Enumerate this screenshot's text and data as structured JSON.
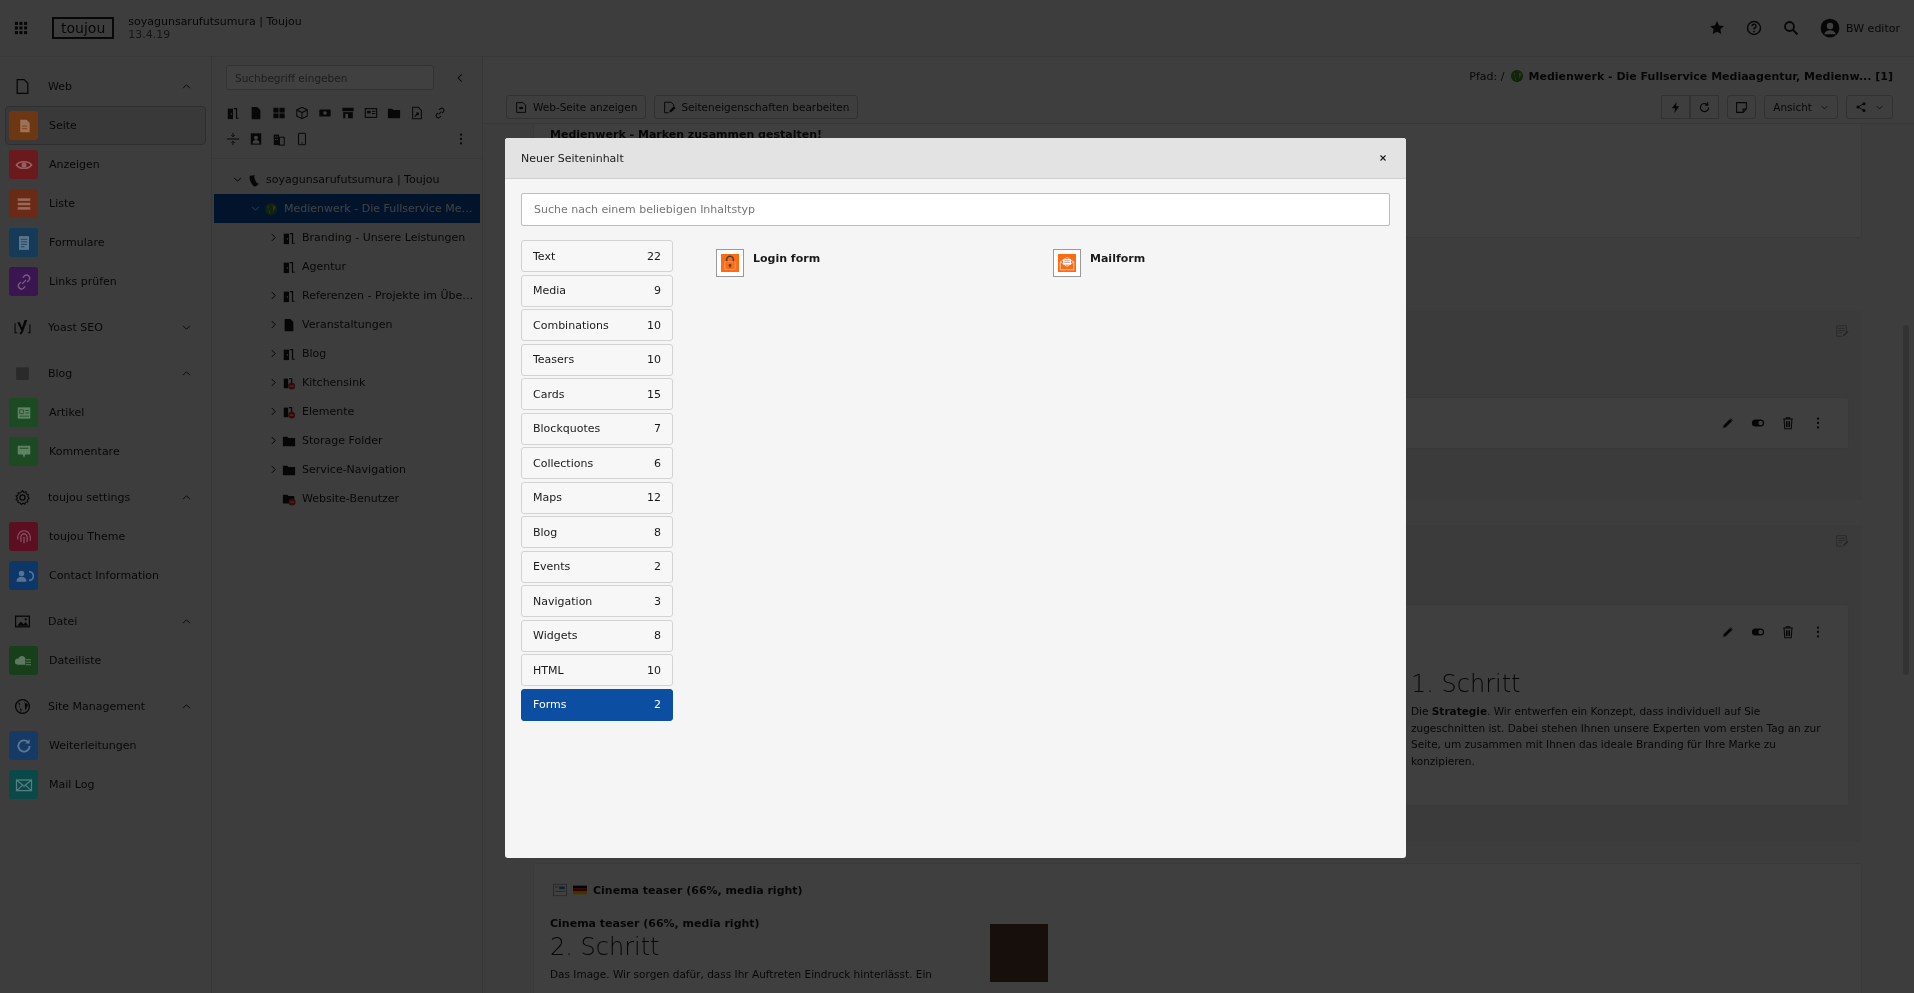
{
  "topbar": {
    "logo": "toujou",
    "site_name": "soyagunsarufutsumura | Toujou",
    "version": "13.4.19",
    "user": "BW editor"
  },
  "modules": [
    {
      "label": "Web",
      "expanded": true,
      "items": [
        {
          "label": "Seite",
          "color": "#6e3714",
          "selected": true
        },
        {
          "label": "Anzeigen",
          "color": "#6a1a1c",
          "selected": false
        },
        {
          "label": "Liste",
          "color": "#6a2a16",
          "selected": false
        },
        {
          "label": "Formulare",
          "color": "#163b58",
          "selected": false
        },
        {
          "label": "Links prüfen",
          "color": "#3a1650",
          "selected": false
        }
      ]
    },
    {
      "label": "Yoast SEO",
      "expanded": false
    },
    {
      "label": "Blog",
      "expanded": true,
      "items": [
        {
          "label": "Artikel",
          "color": "#1c4a22",
          "selected": false
        },
        {
          "label": "Kommentare",
          "color": "#1c4a22",
          "selected": false
        }
      ]
    },
    {
      "label": "toujou settings",
      "expanded": true,
      "items": [
        {
          "label": "toujou Theme",
          "color": "#5c0f22",
          "selected": false
        },
        {
          "label": "Contact Information",
          "color": "#0d3766",
          "selected": false
        }
      ]
    },
    {
      "label": "Datei",
      "expanded": true,
      "items": [
        {
          "label": "Dateiliste",
          "color": "#173f1a",
          "selected": false
        }
      ]
    },
    {
      "label": "Site Management",
      "expanded": true,
      "items": [
        {
          "label": "Weiterleitungen",
          "color": "#153a66",
          "selected": false
        },
        {
          "label": "Mail Log",
          "color": "#0b4848",
          "selected": false
        }
      ]
    }
  ],
  "page_tree": {
    "search": {
      "placeholder": "Suchbegriff eingeben"
    },
    "nodes": [
      {
        "label": "soyagunsarufutsumura | Toujou",
        "kind": "site",
        "has_children": true,
        "expanded": true,
        "selected": false,
        "children": [
          {
            "label": "Medienwerk - Die Fullservice Me…",
            "kind": "globe",
            "has_children": true,
            "expanded": true,
            "selected": true,
            "children": [
              {
                "label": "Branding - Unsere Leistungen",
                "kind": "shortcut",
                "has_children": true,
                "expanded": false,
                "selected": false
              },
              {
                "label": "Agentur",
                "kind": "shortcut",
                "has_children": false,
                "selected": false
              },
              {
                "label": "Referenzen - Projekte im Übe…",
                "kind": "shortcut",
                "has_children": true,
                "expanded": false,
                "selected": false
              },
              {
                "label": "Veranstaltungen",
                "kind": "page",
                "has_children": true,
                "expanded": false,
                "selected": false
              },
              {
                "label": "Blog",
                "kind": "shortcut",
                "has_children": true,
                "expanded": false,
                "selected": false
              },
              {
                "label": "Kitchensink",
                "kind": "restricted",
                "has_children": true,
                "expanded": false,
                "selected": false
              },
              {
                "label": "Elemente",
                "kind": "restricted",
                "has_children": true,
                "expanded": false,
                "selected": false
              },
              {
                "label": "Storage Folder",
                "kind": "folder",
                "has_children": true,
                "expanded": false,
                "selected": false
              },
              {
                "label": "Service-Navigation",
                "kind": "folder",
                "has_children": true,
                "expanded": false,
                "selected": false
              },
              {
                "label": "Website-Benutzer",
                "kind": "folder-restricted",
                "has_children": false,
                "selected": false
              }
            ]
          }
        ]
      }
    ]
  },
  "docheader": {
    "path_label": "Pfad: /",
    "path": "Medienwerk - Die Fullservice Mediaagentur, Medienw... [1]",
    "buttons": [
      "Web-Seite anzeigen",
      "Seiteneigenschaften bearbeiten"
    ],
    "view_menu": "Ansicht"
  },
  "content": {
    "intro_heading": "Medienwerk - Marken zusammen gestalten!",
    "step1": {
      "heading": "1. Schritt",
      "text": "Die **Strategie**. Wir entwerfen ein Konzept, dass individuell auf Sie zugeschnitten ist. Dabei stehen Ihnen unsere Experten vom ersten Tag an zur Seite, um zusammen mit Ihnen das ideale Branding für Ihre Marke zu konzipieren."
    },
    "cinema": {
      "header": "Cinema teaser (66%, media right)",
      "subtitle": "Cinema teaser (66%, media right)",
      "heading": "2. Schritt",
      "text": "Das Image. Wir sorgen dafür, dass Ihr Auftreten Eindruck hinterlässt. Ein"
    }
  },
  "modal": {
    "title": "Neuer Seiteninhalt",
    "search": {
      "placeholder": "Suche nach einem beliebigen Inhaltstyp"
    },
    "categories": [
      {
        "label": "Text",
        "count": "22",
        "selected": false
      },
      {
        "label": "Media",
        "count": "9",
        "selected": false
      },
      {
        "label": "Combinations",
        "count": "10",
        "selected": false
      },
      {
        "label": "Teasers",
        "count": "10",
        "selected": false
      },
      {
        "label": "Cards",
        "count": "15",
        "selected": false
      },
      {
        "label": "Blockquotes",
        "count": "7",
        "selected": false
      },
      {
        "label": "Collections",
        "count": "6",
        "selected": false
      },
      {
        "label": "Maps",
        "count": "12",
        "selected": false
      },
      {
        "label": "Blog",
        "count": "8",
        "selected": false
      },
      {
        "label": "Events",
        "count": "2",
        "selected": false
      },
      {
        "label": "Navigation",
        "count": "3",
        "selected": false
      },
      {
        "label": "Widgets",
        "count": "8",
        "selected": false
      },
      {
        "label": "HTML",
        "count": "10",
        "selected": false
      },
      {
        "label": "Forms",
        "count": "2",
        "selected": true
      }
    ],
    "elements": [
      {
        "label": "Login form"
      },
      {
        "label": "Mailform"
      }
    ]
  }
}
